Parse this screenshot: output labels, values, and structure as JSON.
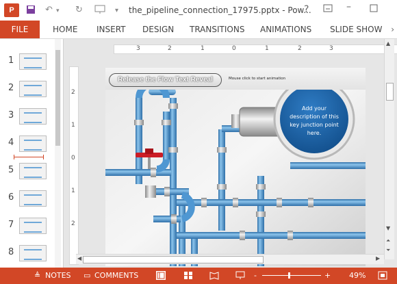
{
  "titlebar": {
    "app_logo": "P",
    "window_title": "the_pipeline_connection_17975.pptx - Pow...",
    "help": "?",
    "icons": [
      "save-icon",
      "undo-icon",
      "redo-icon",
      "present-icon",
      "customize-arrow-icon",
      "help-icon",
      "ribbon-display-icon",
      "minimize-icon",
      "maximize-icon"
    ]
  },
  "ribbon": {
    "file_label": "FILE",
    "tabs": [
      "HOME",
      "INSERT",
      "DESIGN",
      "TRANSITIONS",
      "ANIMATIONS",
      "SLIDE SHOW"
    ],
    "more": "›"
  },
  "slides_panel": {
    "items": [
      {
        "number": "1"
      },
      {
        "number": "2"
      },
      {
        "number": "3"
      },
      {
        "number": "4"
      },
      {
        "number": "5"
      },
      {
        "number": "6"
      },
      {
        "number": "7"
      },
      {
        "number": "8"
      }
    ]
  },
  "rulers": {
    "horizontal_ticks": [
      "3",
      "2",
      "1",
      "0",
      "1",
      "2",
      "3"
    ],
    "vertical_ticks": [
      "2",
      "1",
      "0",
      "1",
      "2"
    ]
  },
  "slide": {
    "button_label": "Release the Flow Text Reveal",
    "hint": "Mouse click to start animation",
    "callout_text": "Add your description of this key junction point here.",
    "colors": {
      "pipe": "#4f97d2",
      "callout": "#1a63a8",
      "valve": "#cc1d26"
    }
  },
  "statusbar": {
    "notes_label": "NOTES",
    "comments_label": "COMMENTS",
    "zoom_label": "49%",
    "zoom_minus": "-",
    "zoom_plus": "+"
  }
}
